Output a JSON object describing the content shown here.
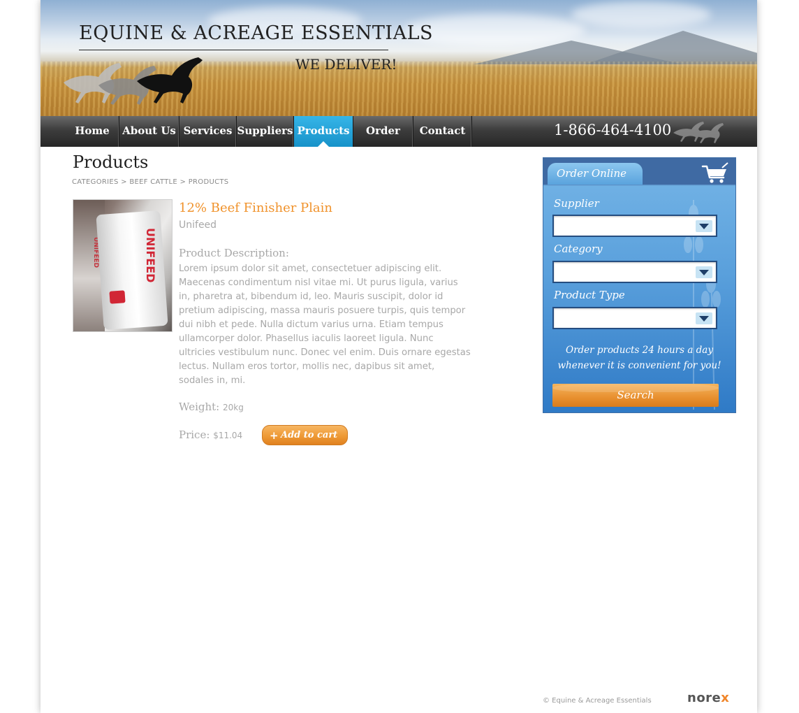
{
  "brand": {
    "title": "EQUINE & ACREAGE ESSENTIALS",
    "tagline": "WE DELIVER!",
    "phone": "1-866-464-4100"
  },
  "nav": {
    "items": [
      {
        "label": "Home",
        "active": false
      },
      {
        "label": "About Us",
        "active": false
      },
      {
        "label": "Services",
        "active": false
      },
      {
        "label": "Suppliers",
        "active": false
      },
      {
        "label": "Products",
        "active": true
      },
      {
        "label": "Order",
        "active": false
      },
      {
        "label": "Contact",
        "active": false
      }
    ]
  },
  "page": {
    "title": "Products",
    "breadcrumb": [
      "CATEGORIES",
      "BEEF CATTLE",
      "PRODUCTS"
    ],
    "breadcrumb_separator": ">"
  },
  "product": {
    "name": "12% Beef Finisher Plain",
    "brand": "Unifeed",
    "description_label": "Product Description:",
    "description": "Lorem ipsum dolor sit amet, consectetuer adipiscing elit. Maecenas condimentum nisl vitae mi. Ut purus ligula, varius in, pharetra at, bibendum id, leo. Mauris suscipit, dolor id pretium adipiscing, massa mauris posuere turpis, quis tempor dui nibh et pede. Nulla dictum varius urna. Etiam tempus ullamcorper dolor. Phasellus iaculis laoreet ligula. Nunc ultricies vestibulum nunc. Donec vel enim. Duis ornare egestas lectus. Nullam eros tortor, mollis nec, dapibus sit amet, sodales in, mi.",
    "weight_label": "Weight:",
    "weight_value": "20kg",
    "price_label": "Price:",
    "price_value": "$11.04",
    "add_to_cart_label": "Add to cart",
    "image_text": "UNIFEED"
  },
  "order_panel": {
    "title": "Order Online",
    "fields": [
      {
        "label": "Supplier",
        "value": ""
      },
      {
        "label": "Category",
        "value": ""
      },
      {
        "label": "Product Type",
        "value": ""
      }
    ],
    "note": "Order products 24 hours a day whenever it is convenient for you!",
    "search_label": "Search"
  },
  "footer": {
    "copyright": "© Equine & Acreage Essentials",
    "credit_main": "nore",
    "credit_x": "x"
  },
  "colors": {
    "accent_blue": "#1792c9",
    "accent_orange": "#f0922b",
    "panel_blue": "#3f6aa3"
  },
  "icons": {
    "cart": "shopping-cart-icon",
    "horses": "running-horses-logo",
    "add": "plus-icon",
    "dropdown": "dropdown-arrow-icon"
  }
}
